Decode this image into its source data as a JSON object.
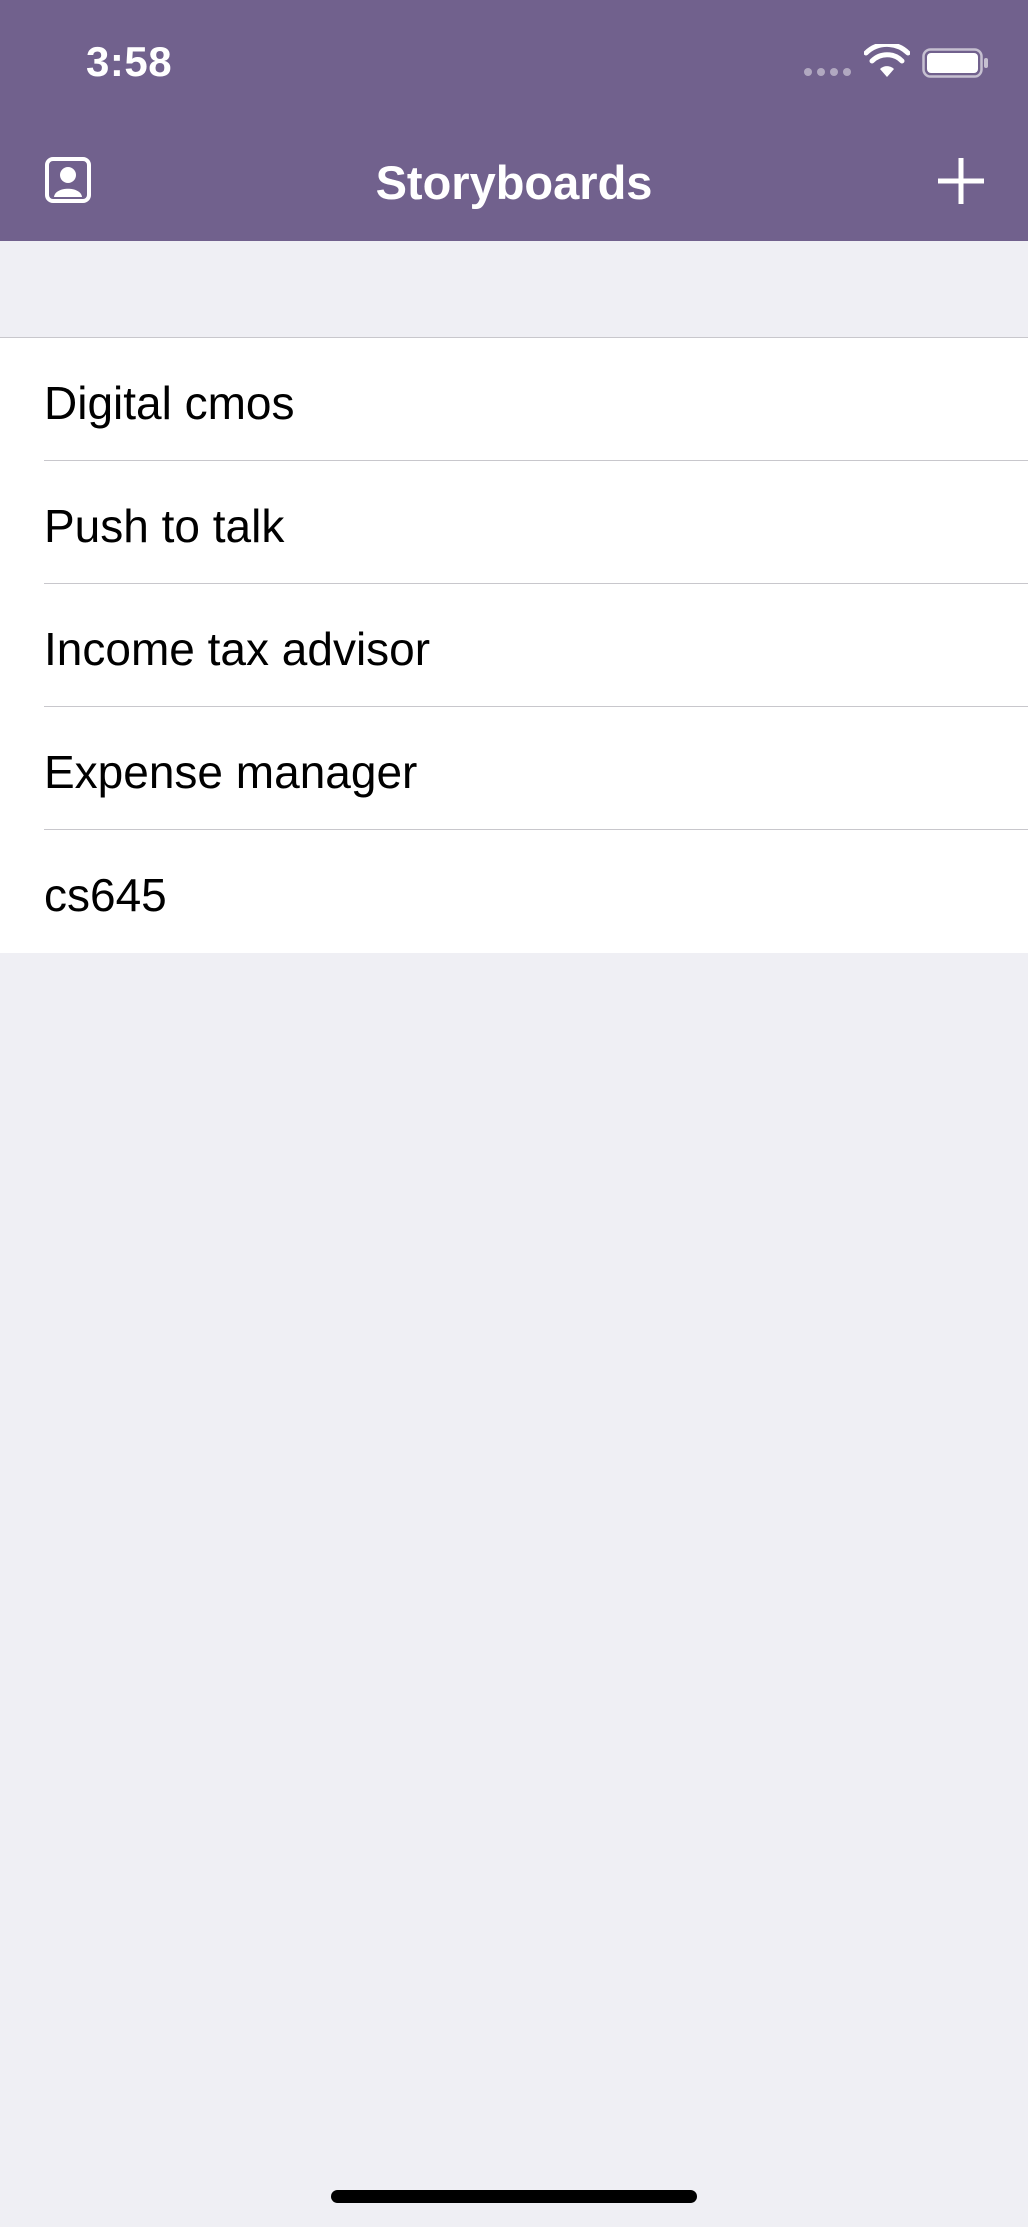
{
  "status_bar": {
    "time": "3:58"
  },
  "nav_bar": {
    "title": "Storyboards",
    "left_icon": "contact-card-icon",
    "right_icon": "plus-icon"
  },
  "storyboards": [
    {
      "name": "Digital cmos"
    },
    {
      "name": "Push to talk"
    },
    {
      "name": "Income tax advisor"
    },
    {
      "name": "Expense manager"
    },
    {
      "name": "cs645"
    }
  ],
  "colors": {
    "nav_background": "#71618d",
    "page_background": "#efeff4",
    "list_background": "#ffffff",
    "separator": "#c8c7cc"
  }
}
